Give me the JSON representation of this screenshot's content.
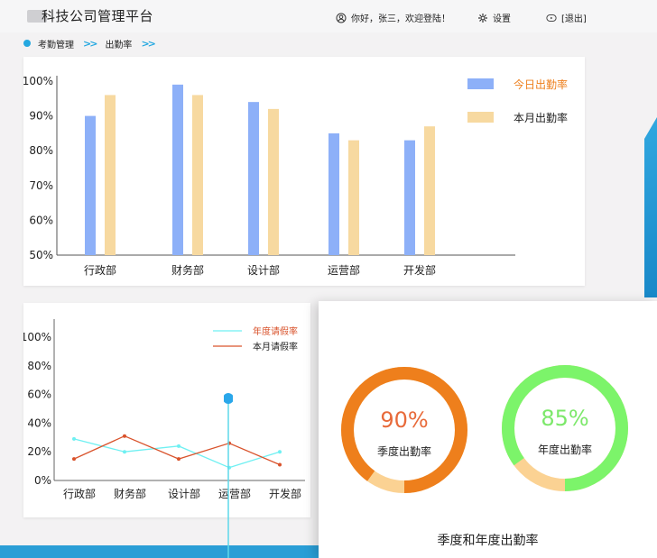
{
  "header": {
    "app_title": "科技公司管理平台",
    "greeting": "你好，张三，欢迎登陆！",
    "settings_label": "设置",
    "logout_label": "[退出]"
  },
  "breadcrumb": {
    "level1": "考勤管理",
    "level2": "出勤率"
  },
  "colors": {
    "accent": "#25a8e0",
    "blue_bar": "#8db0f8",
    "yellow_bar": "#f7d9a0",
    "orange": "#ee7f1c",
    "green": "#7cf46a"
  },
  "chart_data": [
    {
      "type": "bar",
      "categories": [
        "行政部",
        "财务部",
        "设计部",
        "运营部",
        "开发部"
      ],
      "series": [
        {
          "name": "今日出勤率",
          "values": [
            90,
            99,
            94,
            85,
            83
          ],
          "color": "#8db0f8"
        },
        {
          "name": "本月出勤率",
          "values": [
            96,
            96,
            92,
            83,
            87
          ],
          "color": "#f7d9a0"
        }
      ],
      "ylim": [
        50,
        100
      ],
      "yticks": [
        "50%",
        "60%",
        "70%",
        "80%",
        "90%",
        "100%"
      ],
      "legend": "top-right"
    },
    {
      "type": "line",
      "categories": [
        "行政部",
        "财务部",
        "设计部",
        "运营部",
        "开发部"
      ],
      "series": [
        {
          "name": "年度请假率",
          "values": [
            29,
            20,
            24,
            9,
            20
          ],
          "color": "#6ff0f2"
        },
        {
          "name": "本月请假率",
          "values": [
            15,
            31,
            15,
            26,
            11
          ],
          "color": "#d9532c"
        }
      ],
      "ylim": [
        0,
        100
      ],
      "yticks": [
        "0%",
        "20%",
        "40%",
        "60%",
        "80%",
        "100%"
      ],
      "legend": "top-right"
    },
    {
      "type": "pie",
      "title": "季度和年度出勤率",
      "series": [
        {
          "name": "季度出勤率",
          "value": 90,
          "label": "90%",
          "color": "#ee7f1c",
          "rest_color": "#fbd293"
        },
        {
          "name": "年度出勤率",
          "value": 85,
          "label": "85%",
          "color": "#7cf46a",
          "rest_color": "#fbd293"
        }
      ]
    }
  ]
}
